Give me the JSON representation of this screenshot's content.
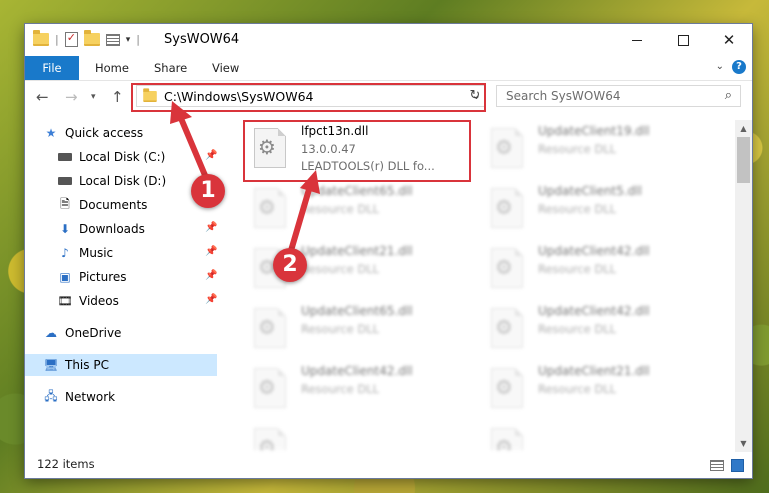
{
  "window": {
    "title": "SysWOW64"
  },
  "ribbon": {
    "tabs": [
      "File",
      "Home",
      "Share",
      "View"
    ],
    "help": "?"
  },
  "address": {
    "path": "C:\\Windows\\SysWOW64"
  },
  "search": {
    "placeholder": "Search SysWOW64"
  },
  "sidebar": {
    "items": [
      {
        "label": "Quick access",
        "icon": "star-icon"
      },
      {
        "label": "Local Disk (C:)",
        "icon": "drive-icon",
        "pinned": true
      },
      {
        "label": "Local Disk (D:)",
        "icon": "drive-icon"
      },
      {
        "label": "Documents",
        "icon": "documents-icon",
        "pinned": true
      },
      {
        "label": "Downloads",
        "icon": "downloads-icon",
        "pinned": true
      },
      {
        "label": "Music",
        "icon": "music-icon",
        "pinned": true
      },
      {
        "label": "Pictures",
        "icon": "pictures-icon",
        "pinned": true
      },
      {
        "label": "Videos",
        "icon": "videos-icon",
        "pinned": true
      },
      {
        "label": "OneDrive",
        "icon": "onedrive-icon"
      },
      {
        "label": "This PC",
        "icon": "this-pc-icon",
        "selected": true
      },
      {
        "label": "Network",
        "icon": "network-icon"
      }
    ]
  },
  "files": {
    "highlighted": {
      "name": "lfpct13n.dll",
      "version": "13.0.0.47",
      "description": "LEADTOOLS(r) DLL fo..."
    },
    "items": [
      {
        "name": "UpdateClient19.dll",
        "type": "Resource DLL"
      },
      {
        "name": "UpdateClient5.dll",
        "type": "Resource DLL"
      },
      {
        "name": "UpdateClient65.dll",
        "type": "Resource DLL"
      },
      {
        "name": "UpdateClient21.dll",
        "type": "Resource DLL"
      },
      {
        "name": "UpdateClient42.dll",
        "type": "Resource DLL"
      },
      {
        "name": "UpdateClient65.dll",
        "type": "Resource DLL"
      },
      {
        "name": "UpdateClient42.dll",
        "type": "Resource DLL"
      },
      {
        "name": "UpdateClient42.dll",
        "type": "Resource DLL"
      },
      {
        "name": "UpdateClient21.dll",
        "type": "Resource DLL"
      }
    ]
  },
  "status": {
    "count": "122 items"
  },
  "annotations": {
    "step1": "1",
    "step2": "2",
    "color": "#d9343b"
  }
}
